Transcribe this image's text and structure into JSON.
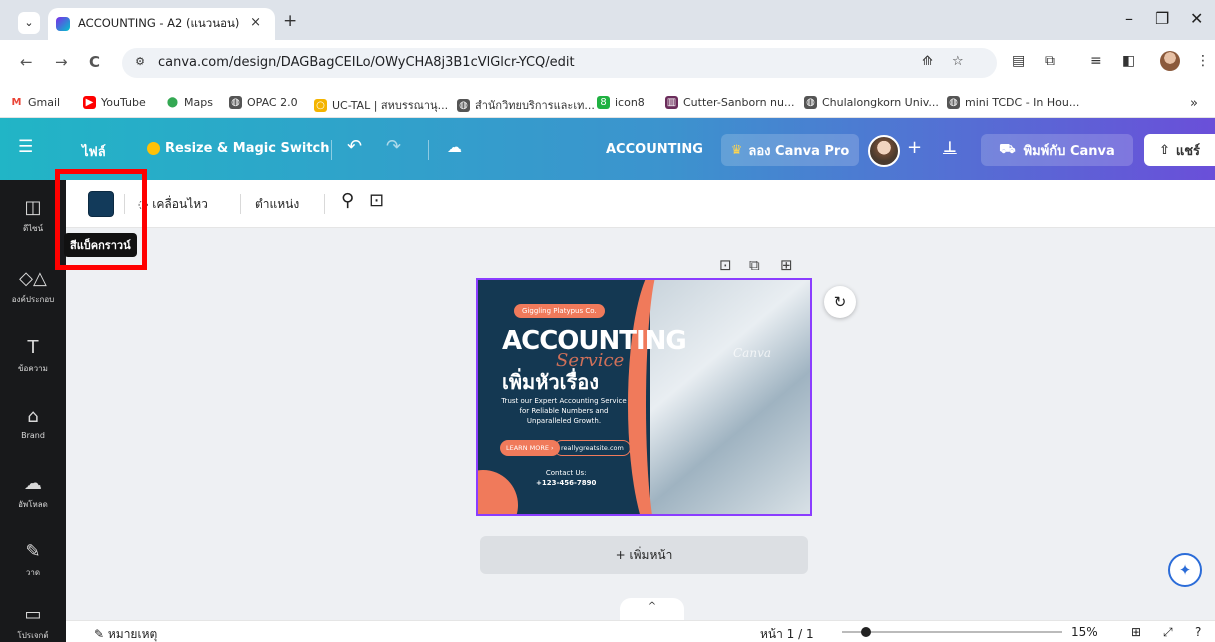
{
  "browser": {
    "tab": {
      "title": "ACCOUNTING - A2 (แนวนอน)",
      "close": "×",
      "new": "+"
    },
    "window": {
      "minimize": "–",
      "restore": "❐",
      "close": "✕"
    },
    "nav": {
      "back": "←",
      "forward": "→",
      "reload": "C"
    },
    "url": "canva.com/design/DAGBagCEILo/OWyCHA8j3B1cVlGlcr-YCQ/edit"
  },
  "bookmarks": [
    {
      "label": "Gmail",
      "icon": "gmail-icon",
      "color": "#ea4335"
    },
    {
      "label": "YouTube",
      "icon": "youtube-icon",
      "color": "#ff0000"
    },
    {
      "label": "Maps",
      "icon": "maps-icon",
      "color": "#34a853"
    },
    {
      "label": "OPAC 2.0",
      "icon": "globe-icon",
      "color": "#555555"
    },
    {
      "label": "UC-TAL | สหบรรณานุ...",
      "icon": "uc-icon",
      "color": "#f4b400"
    },
    {
      "label": "สำนักวิทยบริการและเท...",
      "icon": "globe-icon",
      "color": "#555555"
    },
    {
      "label": "icon8",
      "icon": "icon8-icon",
      "color": "#1fb141"
    },
    {
      "label": "Cutter-Sanborn nu...",
      "icon": "cutter-icon",
      "color": "#6b2d5b"
    },
    {
      "label": "Chulalongkorn Univ...",
      "icon": "globe-icon",
      "color": "#555555"
    },
    {
      "label": "mini TCDC - In Hou...",
      "icon": "globe-icon",
      "color": "#555555"
    }
  ],
  "bookmarks_more": "»",
  "canva": {
    "menu": "☰",
    "file": "ไฟล์",
    "resize": "Resize & Magic Switch",
    "undo": "↶",
    "redo": "↷",
    "saved": "☁",
    "doc_title": "ACCOUNTING",
    "try_pro": "ลอง Canva Pro",
    "add": "+",
    "insights": "⊥",
    "print": "พิมพ์กับ Canva",
    "share": "แชร์",
    "brand_color": "#8b3dff"
  },
  "sidebar": [
    {
      "label": "ดีไซน์",
      "icon": "design-icon"
    },
    {
      "label": "องค์ประกอบ",
      "icon": "elements-icon"
    },
    {
      "label": "ข้อความ",
      "icon": "text-icon"
    },
    {
      "label": "Brand",
      "icon": "brand-icon"
    },
    {
      "label": "อัพโหลด",
      "icon": "upload-icon"
    },
    {
      "label": "วาด",
      "icon": "draw-icon"
    },
    {
      "label": "โปรเจกต์",
      "icon": "projects-icon"
    }
  ],
  "toolbar": {
    "swatch_color": "#123a5a",
    "tooltip": "สีแบ็คกราวน์",
    "animate": "เคลื่อนไหว",
    "position": "ตำแหน่ง"
  },
  "design": {
    "brand": "Giggling Platypus Co.",
    "title": "ACCOUNTING",
    "script": "Service",
    "heading": "เพิ่มหัวเรื่อง",
    "body": "Trust our Expert Accounting Service for Reliable Numbers and Unparalleled Growth.",
    "learn_more": "LEARN MORE ›",
    "site": "reallygreatsite.com",
    "contact_label": "Contact Us:",
    "phone": "+123-456-7890",
    "watermark": "Canva",
    "bg_color": "#143852",
    "accent_color": "#f07a5b"
  },
  "canvas": {
    "add_page": "+ เพิ่มหน้า"
  },
  "footer": {
    "notes": "หมายเหตุ",
    "page": "หน้า 1 / 1",
    "zoom": "15%",
    "zoom_fraction": 0.15
  }
}
